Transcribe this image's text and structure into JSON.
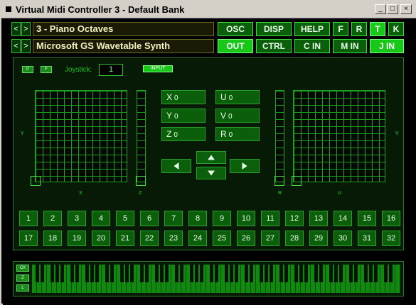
{
  "window": {
    "title": "Virtual Midi Controller 3 - Default Bank",
    "controls": [
      "_",
      "□",
      "×"
    ]
  },
  "top": {
    "bank_nav": [
      "<",
      ">"
    ],
    "device_nav": [
      "<",
      ">"
    ],
    "preset_name": "3 - Piano Octaves",
    "device_name": "Microsoft GS Wavetable Synth",
    "row1_buttons": [
      "OSC",
      "DISP",
      "HELP",
      "F",
      "R",
      "T",
      "K"
    ],
    "row2_buttons": [
      "OUT",
      "CTRL",
      "C IN",
      "M IN",
      "J IN"
    ]
  },
  "panel": {
    "p_label": "P",
    "f_label": "F",
    "joystick_label": "Joystick:",
    "joystick_value": "1",
    "input_label": "INPUT",
    "axis_left_y": "Y",
    "axis_right_v": "V",
    "label_x": "X",
    "label_z": "Z",
    "label_r": "R",
    "label_u": "U",
    "readouts": [
      {
        "axis": "X",
        "value": "0"
      },
      {
        "axis": "U",
        "value": "0"
      },
      {
        "axis": "Y",
        "value": "0"
      },
      {
        "axis": "V",
        "value": "0"
      },
      {
        "axis": "Z",
        "value": "0"
      },
      {
        "axis": "R",
        "value": "0"
      }
    ],
    "pads_row1": [
      "1",
      "2",
      "3",
      "4",
      "5",
      "6",
      "7",
      "8",
      "9",
      "10",
      "11",
      "12",
      "13",
      "14",
      "15",
      "16"
    ],
    "pads_row2": [
      "17",
      "18",
      "19",
      "20",
      "21",
      "22",
      "23",
      "24",
      "25",
      "26",
      "27",
      "28",
      "29",
      "30",
      "31",
      "32"
    ]
  },
  "keyboard": {
    "side_buttons": [
      "CK",
      "Z",
      "L"
    ]
  },
  "colors": {
    "accent": "#18c818",
    "button": "#0b5f0b",
    "grid": "#1aa01a",
    "field_text": "#f2f2c0"
  }
}
